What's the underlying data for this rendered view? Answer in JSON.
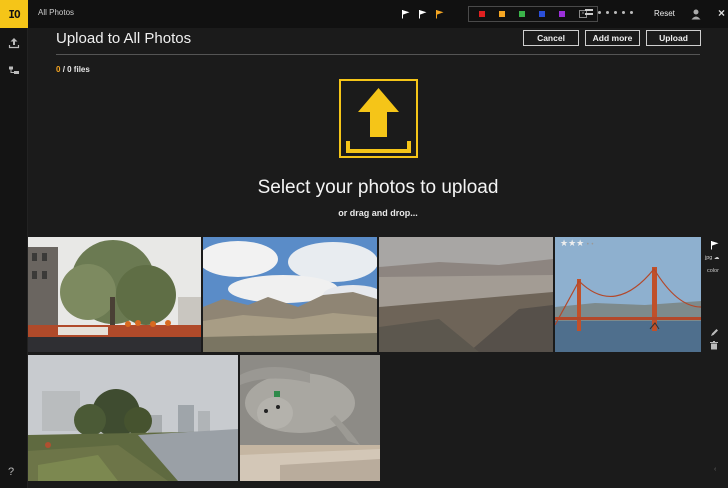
{
  "app": {
    "logo_text": "IO",
    "title": "All Photos",
    "help_label": "?"
  },
  "toolbar": {
    "flags": [
      {
        "name": "flag-white",
        "color": "#ffffff"
      },
      {
        "name": "flag-white-2",
        "color": "#ffffff"
      },
      {
        "name": "flag-orange",
        "color": "#f5a623"
      }
    ],
    "color_labels": [
      {
        "name": "red",
        "color": "#e02020"
      },
      {
        "name": "orange",
        "color": "#f5a623"
      },
      {
        "name": "green",
        "color": "#3bb34a"
      },
      {
        "name": "blue",
        "color": "#2b4fd8"
      },
      {
        "name": "purple",
        "color": "#9b30d9"
      }
    ],
    "reset_label": "Reset",
    "close_label": "×"
  },
  "upload": {
    "title": "Upload to All Photos",
    "cancel_label": "Cancel",
    "add_more_label": "Add more",
    "upload_label": "Upload",
    "files_done": "0",
    "files_total": "/ 0 files",
    "select_text": "Select your photos to upload",
    "drag_text": "or drag and drop...",
    "accent_color": "#f5c518"
  },
  "photos": [
    {
      "name": "amsterdam-canal",
      "icon": "photo-city-canal"
    },
    {
      "name": "desert-badlands",
      "icon": "photo-badlands"
    },
    {
      "name": "desert-valley",
      "icon": "photo-valley"
    },
    {
      "name": "golden-gate-bridge",
      "icon": "photo-bridge",
      "rating": 3
    },
    {
      "name": "city-park",
      "icon": "photo-park"
    },
    {
      "name": "seal",
      "icon": "photo-seal"
    }
  ],
  "info_panel": {
    "format": "jpg",
    "color_label": "color"
  }
}
